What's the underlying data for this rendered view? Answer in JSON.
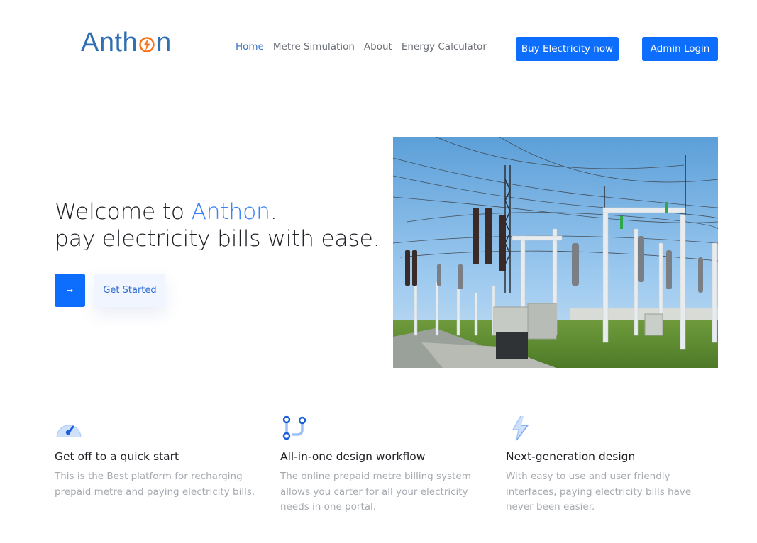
{
  "header": {
    "logo_text_start": "Anth",
    "logo_text_end": "n",
    "nav": [
      {
        "label": "Home",
        "active": true
      },
      {
        "label": "Metre Simulation",
        "active": false
      },
      {
        "label": "About",
        "active": false
      },
      {
        "label": "Energy Calculator",
        "active": false
      }
    ],
    "buy_button": "Buy Electricity now",
    "admin_button": "Admin Login"
  },
  "hero": {
    "line1_prefix": "Welcome to ",
    "line1_brand": "Anthon",
    "line1_suffix": ".",
    "line2": "pay electricity bills with ease.",
    "arrow_button": "→",
    "cta": "Get Started"
  },
  "features": [
    {
      "icon": "speedometer-icon",
      "title": "Get off to a quick start",
      "description": "This is the Best platform for recharging prepaid metre and paying electricity bills."
    },
    {
      "icon": "workflow-icon",
      "title": "All-in-one design workflow",
      "description": "The online prepaid metre billing system allows you carter for all your electricity needs in one portal."
    },
    {
      "icon": "lightning-icon",
      "title": "Next-generation design",
      "description": "With easy to use and user friendly interfaces, paying electricity bills have never been easier."
    }
  ],
  "colors": {
    "primary": "#0d6efd",
    "brand_blue": "#3b82f6",
    "logo_blue": "#2f6fb3",
    "logo_bolt": "#f97316",
    "muted_text": "#a6aab0"
  }
}
